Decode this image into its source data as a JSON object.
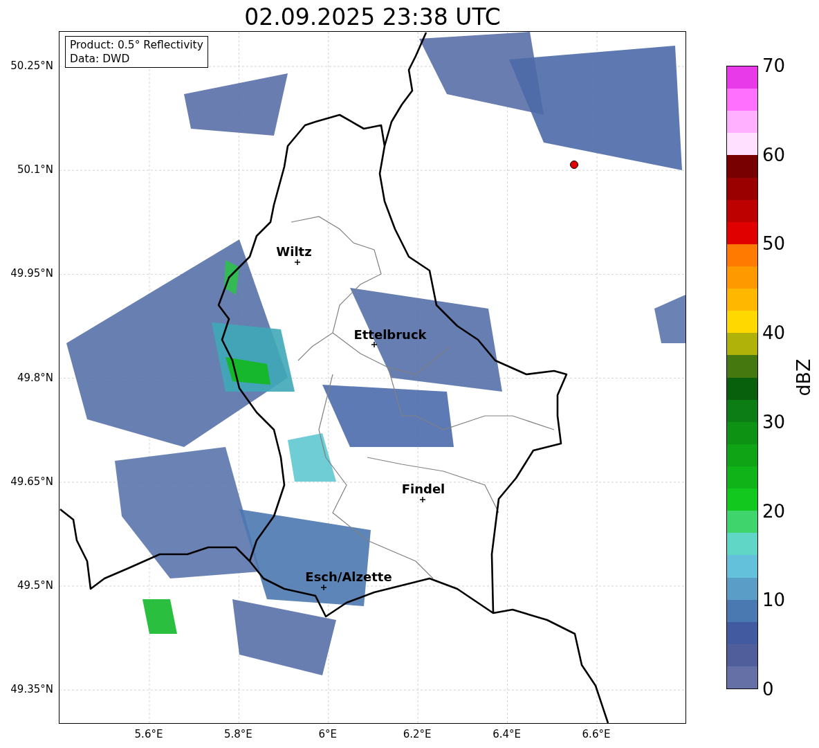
{
  "title": "02.09.2025 23:38 UTC",
  "info_box": {
    "lines": [
      "Product: 0.5° Reflectivity",
      "Data: DWD"
    ]
  },
  "map": {
    "kind": "map",
    "yticks": [
      "50.25°N",
      "50.1°N",
      "49.95°N",
      "49.8°N",
      "49.65°N",
      "49.5°N",
      "49.35°N"
    ],
    "xticks": [
      "5.6°E",
      "5.8°E",
      "6°E",
      "6.2°E",
      "6.4°E",
      "6.6°E"
    ],
    "cities": [
      {
        "name": "Wiltz"
      },
      {
        "name": "Ettelbruck"
      },
      {
        "name": "Findel"
      },
      {
        "name": "Esch/Alzette"
      }
    ]
  },
  "colorbar": {
    "label": "dBZ",
    "ticks": [
      "70",
      "60",
      "50",
      "40",
      "30",
      "20",
      "10",
      "0"
    ],
    "bins": [
      {
        "color": "#6571a6"
      },
      {
        "color": "#505f9c"
      },
      {
        "color": "#425ba0"
      },
      {
        "color": "#4a78b0"
      },
      {
        "color": "#5a9ec8"
      },
      {
        "color": "#63c1dc"
      },
      {
        "color": "#5fd6c6"
      },
      {
        "color": "#3fd56c"
      },
      {
        "color": "#12c81e"
      },
      {
        "color": "#10b418"
      },
      {
        "color": "#0fa416"
      },
      {
        "color": "#0e9214"
      },
      {
        "color": "#0b7d14"
      },
      {
        "color": "#08600d"
      },
      {
        "color": "#45780e"
      },
      {
        "color": "#b0b20a"
      },
      {
        "color": "#ffd800"
      },
      {
        "color": "#ffb700"
      },
      {
        "color": "#ff9900"
      },
      {
        "color": "#ff7a00"
      },
      {
        "color": "#e00000"
      },
      {
        "color": "#bd0000"
      },
      {
        "color": "#9a0000"
      },
      {
        "color": "#780000"
      },
      {
        "color": "#ffe0ff"
      },
      {
        "color": "#ffb0ff"
      },
      {
        "color": "#ff70ff"
      },
      {
        "color": "#e93ae9"
      }
    ]
  }
}
